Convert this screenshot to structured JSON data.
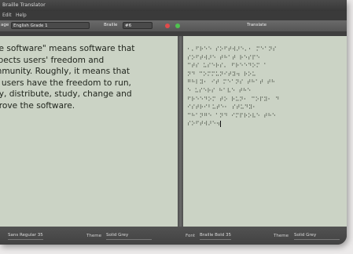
{
  "window": {
    "title": "Braille Translator"
  },
  "menu": [
    "Edit",
    "Help"
  ],
  "toolbar": {
    "language_label": "age",
    "language_value": "English Grade 1",
    "braille_label": "Braille",
    "braille_value": "#6",
    "translate_label": "Translate"
  },
  "left_text": [
    "ee software\" means software that",
    "spects users' freedom and",
    "mmunity. Roughly, it means that",
    "e users have the freedom to run,",
    "py, distribute, study, change and",
    "prove the software."
  ],
  "right_text": [
    "⠂⠄⠋⠗⠑⠑ ⠎⠕⠋⠞⠺⠜⠑⠄⠂ ⠍⠑⠁⠝⠎",
    "⠎⠕⠋⠞⠺⠜⠑ ⠞⠓⠁⠞ ⠗⠑⠎⠏⠑",
    "⠉⠞⠎ ⠥⠎⠑⠗⠎⠄ ⠋⠗⠑⠑⠙⠕⠍ ⠁",
    "⠝⠙ ⠉⠕⠍⠍⠥⠝⠊⠞⠽⠲ ⠗⠕⠥",
    "⠛⠓⠇⠽⠂ ⠊⠞ ⠍⠑⠁⠝⠎ ⠞⠓⠁⠞ ⠞⠓",
    "⠑ ⠥⠎⠑⠗⠎ ⠓⠁⠧⠑ ⠞⠓⠑",
    "⠋⠗⠑⠑⠙⠕⠍ ⠞⠕ ⠗⠥⠝⠂ ⠉⠕⠏⠽⠂ ⠙",
    "⠊⠎⠞⠗⠊⠃⠥⠞⠑⠂ ⠎⠞⠥⠙⠽⠂",
    "⠉⠓⠁⠝⠛⠑ ⠁⠝⠙ ⠊⠍⠏⠗⠕⠧⠑ ⠞⠓⠑",
    "⠎⠕⠋⠞⠺⠜⠑⠲"
  ],
  "status": {
    "font_left_value": "Sans Regular 35",
    "theme_left_label": "Theme",
    "theme_left_value": "Solid Grey",
    "font_right_label": "Font",
    "font_right_value": "Braille Bold 35",
    "theme_right_label": "Theme",
    "theme_right_value": "Solid Grey"
  },
  "colors": {
    "pane_bg": "#cbd3c5",
    "close_dot": "#e04a4a",
    "ok_dot": "#4fc24f"
  }
}
